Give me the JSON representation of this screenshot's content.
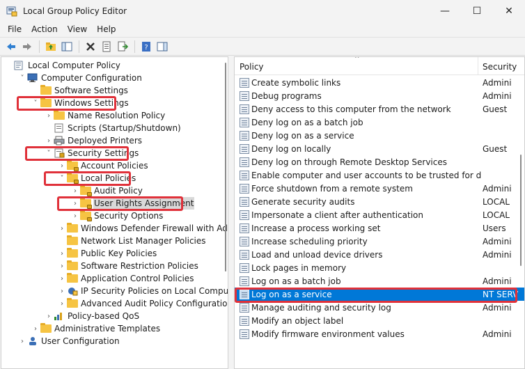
{
  "window": {
    "title": "Local Group Policy Editor",
    "minimize": "—",
    "maximize": "☐",
    "close": "✕"
  },
  "menu": [
    "File",
    "Action",
    "View",
    "Help"
  ],
  "tree": [
    {
      "label": "Local Computer Policy",
      "indent": 0,
      "toggle": "",
      "icon": "computer-policy-icon"
    },
    {
      "label": "Computer Configuration",
      "indent": 1,
      "toggle": "˅",
      "icon": "computer-icon"
    },
    {
      "label": "Software Settings",
      "indent": 2,
      "toggle": "",
      "icon": "folder-icon"
    },
    {
      "label": "Windows Settings",
      "indent": 2,
      "toggle": "˅",
      "icon": "folder-icon"
    },
    {
      "label": "Name Resolution Policy",
      "indent": 3,
      "toggle": "›",
      "icon": "folder-icon"
    },
    {
      "label": "Scripts (Startup/Shutdown)",
      "indent": 3,
      "toggle": "",
      "icon": "scripts-icon"
    },
    {
      "label": "Deployed Printers",
      "indent": 3,
      "toggle": "›",
      "icon": "printer-icon"
    },
    {
      "label": "Security Settings",
      "indent": 3,
      "toggle": "˅",
      "icon": "security-settings-icon"
    },
    {
      "label": "Account Policies",
      "indent": 4,
      "toggle": "›",
      "icon": "locked-folder-icon"
    },
    {
      "label": "Local Policies",
      "indent": 4,
      "toggle": "˅",
      "icon": "locked-folder-icon"
    },
    {
      "label": "Audit Policy",
      "indent": 5,
      "toggle": "›",
      "icon": "locked-folder-icon"
    },
    {
      "label": "User Rights Assignment",
      "indent": 5,
      "toggle": "›",
      "icon": "locked-folder-icon",
      "selected": true
    },
    {
      "label": "Security Options",
      "indent": 5,
      "toggle": "›",
      "icon": "locked-folder-icon"
    },
    {
      "label": "Windows Defender Firewall with Advanc",
      "indent": 4,
      "toggle": "›",
      "icon": "folder-icon"
    },
    {
      "label": "Network List Manager Policies",
      "indent": 4,
      "toggle": "",
      "icon": "folder-icon"
    },
    {
      "label": "Public Key Policies",
      "indent": 4,
      "toggle": "›",
      "icon": "folder-icon"
    },
    {
      "label": "Software Restriction Policies",
      "indent": 4,
      "toggle": "›",
      "icon": "folder-icon"
    },
    {
      "label": "Application Control Policies",
      "indent": 4,
      "toggle": "›",
      "icon": "folder-icon"
    },
    {
      "label": "IP Security Policies on Local Computer",
      "indent": 4,
      "toggle": "›",
      "icon": "ip-security-icon"
    },
    {
      "label": "Advanced Audit Policy Configuration",
      "indent": 4,
      "toggle": "›",
      "icon": "folder-icon"
    },
    {
      "label": "Policy-based QoS",
      "indent": 3,
      "toggle": "›",
      "icon": "qos-chart-icon"
    },
    {
      "label": "Administrative Templates",
      "indent": 2,
      "toggle": "›",
      "icon": "folder-icon"
    },
    {
      "label": "User Configuration",
      "indent": 1,
      "toggle": "›",
      "icon": "user-icon"
    }
  ],
  "list": {
    "col_policy": "Policy",
    "col_security": "Security",
    "rows": [
      {
        "name": "Create symbolic links",
        "security": "Admini"
      },
      {
        "name": "Debug programs",
        "security": "Admini"
      },
      {
        "name": "Deny access to this computer from the network",
        "security": "Guest"
      },
      {
        "name": "Deny log on as a batch job",
        "security": ""
      },
      {
        "name": "Deny log on as a service",
        "security": ""
      },
      {
        "name": "Deny log on locally",
        "security": "Guest"
      },
      {
        "name": "Deny log on through Remote Desktop Services",
        "security": ""
      },
      {
        "name": "Enable computer and user accounts to be trusted for delega...",
        "security": ""
      },
      {
        "name": "Force shutdown from a remote system",
        "security": "Admini"
      },
      {
        "name": "Generate security audits",
        "security": "LOCAL"
      },
      {
        "name": "Impersonate a client after authentication",
        "security": "LOCAL"
      },
      {
        "name": "Increase a process working set",
        "security": "Users"
      },
      {
        "name": "Increase scheduling priority",
        "security": "Admini"
      },
      {
        "name": "Load and unload device drivers",
        "security": "Admini"
      },
      {
        "name": "Lock pages in memory",
        "security": ""
      },
      {
        "name": "Log on as a batch job",
        "security": "Admini"
      },
      {
        "name": "Log on as a service",
        "security": "NT SERV",
        "selected": true
      },
      {
        "name": "Manage auditing and security log",
        "security": "Admini"
      },
      {
        "name": "Modify an object label",
        "security": ""
      },
      {
        "name": "Modify firmware environment values",
        "security": "Admini"
      }
    ]
  },
  "colors": {
    "highlight": "#e0313a",
    "selection": "#0078d7"
  }
}
